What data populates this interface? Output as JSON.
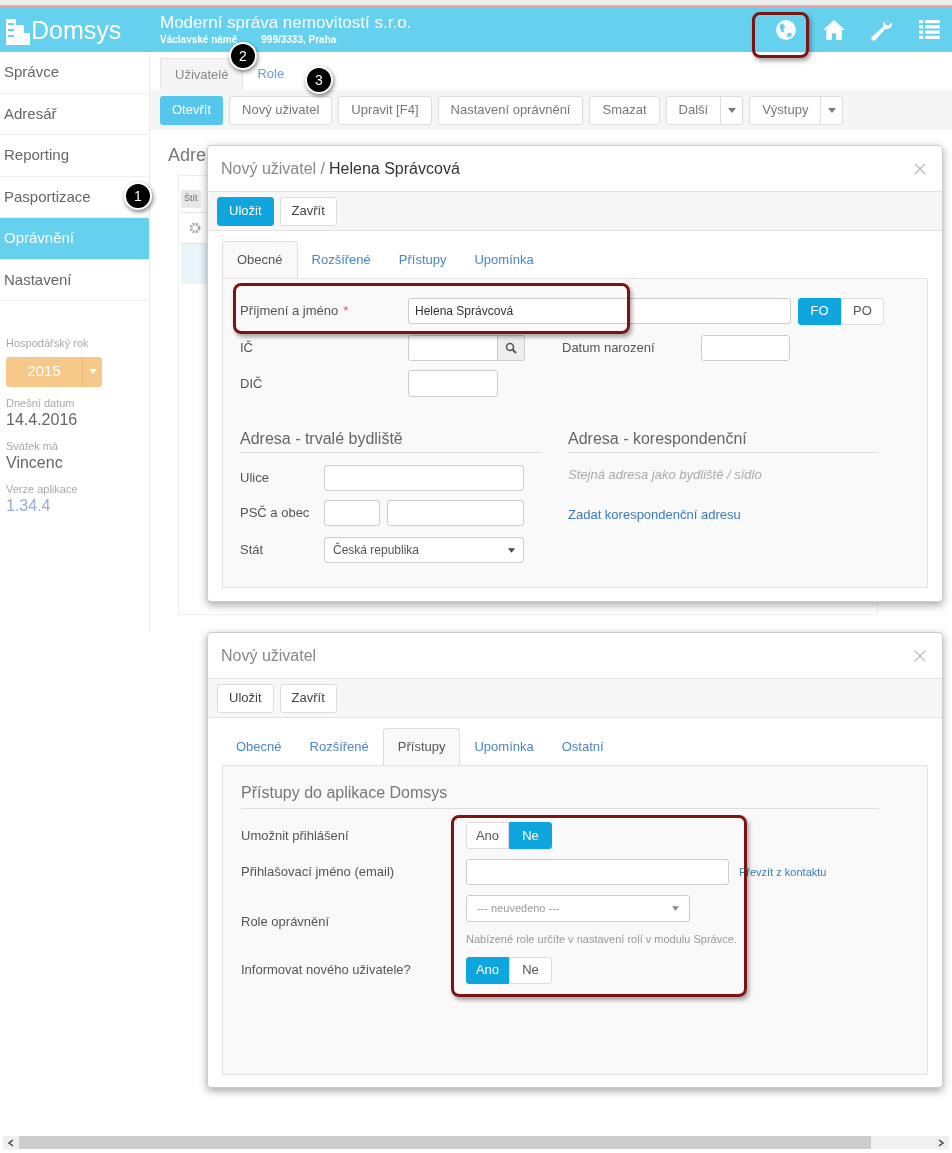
{
  "header": {
    "logo": "Domsys",
    "company": "Moderní správa nemovitostí s.r.o.",
    "address_parts": [
      "Václavské námě",
      "999/3333, Praha"
    ]
  },
  "sidebar": {
    "items": [
      {
        "label": "Správce",
        "selected": false
      },
      {
        "label": "Adresář",
        "selected": false
      },
      {
        "label": "Reporting",
        "selected": false
      },
      {
        "label": "Pasportizace",
        "selected": false
      },
      {
        "label": "Oprávnění",
        "selected": true
      },
      {
        "label": "Nastavení",
        "selected": false
      }
    ],
    "fiscal_year": {
      "label": "Hospodářský rok",
      "value": "2015"
    },
    "info": [
      {
        "label": "Dnešní datum",
        "value": "14.4.2016",
        "kind": "text"
      },
      {
        "label": "Svátek má",
        "value": "Vincenc",
        "kind": "text"
      },
      {
        "label": "Verze aplikace",
        "value": "1.34.4",
        "kind": "link"
      }
    ]
  },
  "main": {
    "tabs": [
      {
        "label": "Uživatelé",
        "selected": true
      },
      {
        "label": "Role",
        "selected": false
      }
    ],
    "toolbar": [
      {
        "label": "Otevřít",
        "primary": true,
        "dropdown": false
      },
      {
        "label": "Nový uživatel",
        "primary": false,
        "dropdown": false
      },
      {
        "label": "Upravit [F4]",
        "primary": false,
        "dropdown": false
      },
      {
        "label": "Nastavení oprávnění",
        "primary": false,
        "dropdown": false
      },
      {
        "label": "Smazat",
        "primary": false,
        "dropdown": false
      },
      {
        "label": "Další",
        "primary": false,
        "dropdown": true
      },
      {
        "label": "Výstupy",
        "primary": false,
        "dropdown": true
      }
    ],
    "heading": "Adre",
    "tag": "Štít"
  },
  "annotations": [
    "1",
    "2",
    "3"
  ],
  "dialog_1": {
    "title_prefix": "Nový uživatel /",
    "title_name": "Helena Správcová",
    "buttons": [
      {
        "label": "Uložit",
        "primary": true
      },
      {
        "label": "Zavřít",
        "primary": false
      }
    ],
    "tabs": [
      {
        "label": "Obecné",
        "selected": true
      },
      {
        "label": "Rozšířené",
        "selected": false
      },
      {
        "label": "Přístupy",
        "selected": false
      },
      {
        "label": "Upomínka",
        "selected": false
      }
    ],
    "name_field": {
      "label": "Příjmení a jméno",
      "required": "*",
      "value": "Helena Správcová"
    },
    "person_type": [
      {
        "label": "FO",
        "selected": true
      },
      {
        "label": "PO",
        "selected": false
      }
    ],
    "ic_label": "IČ",
    "birth_label": "Datum narození",
    "dic_label": "DIČ",
    "permanent_address": {
      "title": "Adresa - trvalé bydliště",
      "street_label": "Ulice",
      "zip_city_label": "PSČ a obec",
      "country_label": "Stát",
      "country_value": "Česká republika"
    },
    "correspondence_address": {
      "title": "Adresa - korespondenční",
      "note": "Stejná adresa jako bydliště / sídlo",
      "link": "Zadat korespondenční adresu"
    }
  },
  "dialog_2": {
    "title": "Nový uživatel",
    "buttons": [
      {
        "label": "Uložit",
        "primary": false
      },
      {
        "label": "Zavřít",
        "primary": false
      }
    ],
    "tabs": [
      {
        "label": "Obecné",
        "selected": false
      },
      {
        "label": "Rozšířené",
        "selected": false
      },
      {
        "label": "Přístupy",
        "selected": true
      },
      {
        "label": "Upomínka",
        "selected": false
      },
      {
        "label": "Ostatní",
        "selected": false
      }
    ],
    "section_title": "Přístupy do aplikace Domsys",
    "login": {
      "label": "Umožnit přihlášení",
      "options": [
        {
          "label": "Ano",
          "selected": false
        },
        {
          "label": "Ne",
          "selected": true
        }
      ]
    },
    "email": {
      "label": "Přihlašovací jméno (email)",
      "link": "Převzít z kontaktu"
    },
    "role": {
      "label": "Role oprávnění",
      "placeholder": "--- neuvedeno ---",
      "help": "Nabízené role určíte v nastavení rolí v modulu Správce."
    },
    "notify": {
      "label": "Informovat nového uživatele?",
      "options": [
        {
          "label": "Ano",
          "selected": true
        },
        {
          "label": "Ne",
          "selected": false
        }
      ]
    }
  }
}
